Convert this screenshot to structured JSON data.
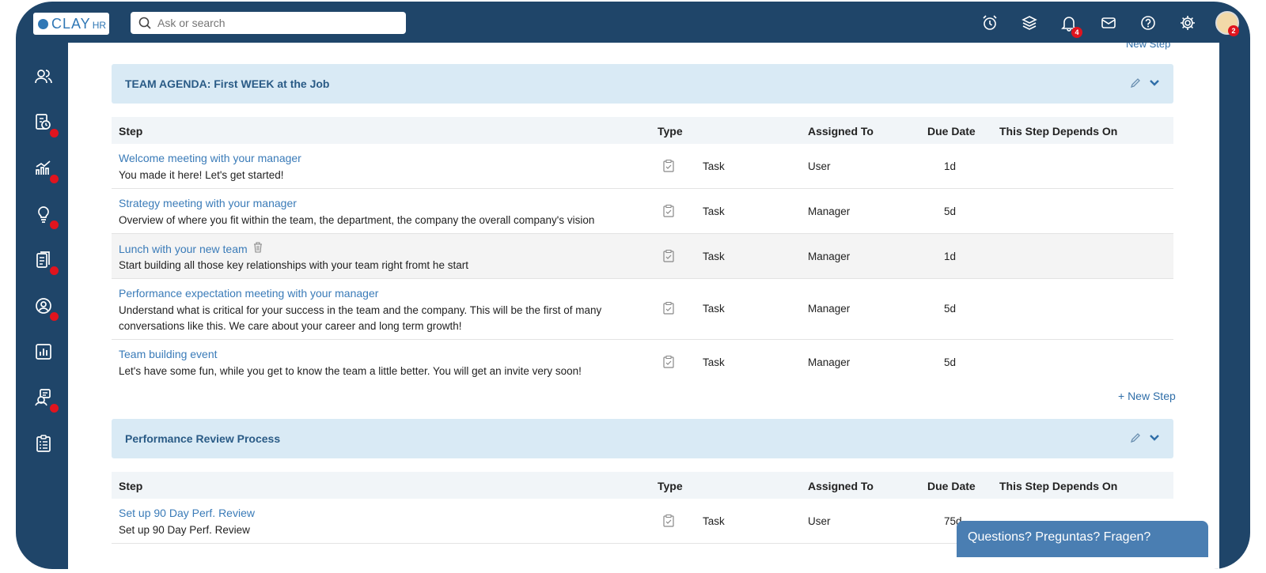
{
  "brand": {
    "logo_main": "CLAY",
    "logo_sub": "HR"
  },
  "search": {
    "placeholder": "Ask or search"
  },
  "topbar": {
    "icons": [
      "alarm-clock-icon",
      "layers-icon",
      "bell-icon",
      "mail-icon",
      "help-icon",
      "gear-icon"
    ],
    "notifications_count": "4",
    "avatar_badge": "2"
  },
  "sidebar": {
    "items": [
      {
        "icon": "people-icon",
        "dot": false
      },
      {
        "icon": "payroll-clock-icon",
        "dot": true
      },
      {
        "icon": "growth-chart-icon",
        "dot": true
      },
      {
        "icon": "lightbulb-icon",
        "dot": true
      },
      {
        "icon": "documents-icon",
        "dot": true
      },
      {
        "icon": "user-circle-icon",
        "dot": true
      },
      {
        "icon": "bar-chart-icon",
        "dot": false
      },
      {
        "icon": "support-agent-icon",
        "dot": true
      },
      {
        "icon": "checklist-icon",
        "dot": false
      }
    ]
  },
  "top_new_step": "New Step",
  "columns": {
    "step": "Step",
    "type": "Type",
    "assigned": "Assigned To",
    "due": "Due Date",
    "depends": "This Step Depends On"
  },
  "sections": [
    {
      "title": "TEAM AGENDA: First WEEK at the Job",
      "rows": [
        {
          "title": "Welcome meeting with your manager",
          "desc": "You made it here! Let's get started!",
          "type": "Task",
          "assigned": "User",
          "due": "1d"
        },
        {
          "title": "Strategy meeting with your manager",
          "desc": "Overview of where you fit within the team, the department, the company the overall company's vision",
          "type": "Task",
          "assigned": "Manager",
          "due": "5d"
        },
        {
          "title": "Lunch with your new team",
          "desc": "Start building all those key relationships with your team right fromt he start",
          "type": "Task",
          "assigned": "Manager",
          "due": "1d"
        },
        {
          "title": "Performance expectation meeting with your manager",
          "desc": "Understand what is critical for your success in the team and the company. This will be the first of many conversations like this. We care about your career and long term growth!",
          "type": "Task",
          "assigned": "Manager",
          "due": "5d"
        },
        {
          "title": "Team building event",
          "desc": "Let's have some fun, while you get to know the team a little better. You will get an invite very soon!",
          "type": "Task",
          "assigned": "Manager",
          "due": "5d"
        }
      ],
      "new_step": "+ New Step"
    },
    {
      "title": "Performance Review Process",
      "rows": [
        {
          "title": "Set up 90 Day Perf. Review",
          "desc": "Set up 90 Day Perf. Review",
          "type": "Task",
          "assigned": "User",
          "due": "75d"
        }
      ]
    }
  ],
  "chat": {
    "label": "Questions? Preguntas? Fragen?"
  }
}
